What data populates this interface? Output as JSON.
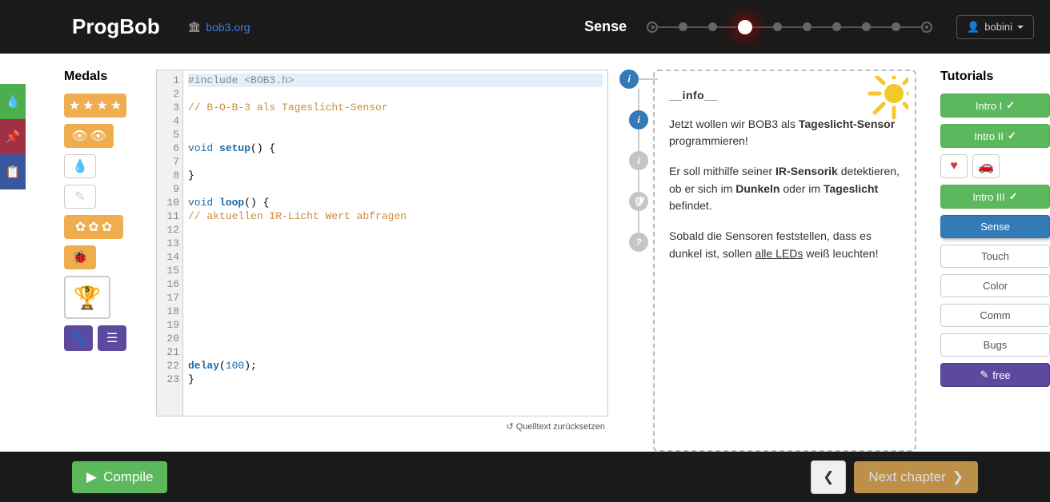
{
  "header": {
    "logo": "ProgBob",
    "domain": "bob3.org",
    "crumb": "Sense",
    "user": "bobini"
  },
  "medals": {
    "title": "Medals",
    "trophy_num": "5"
  },
  "editor": {
    "lines": [
      "1",
      "2",
      "3",
      "4",
      "5",
      "6",
      "7",
      "8",
      "9",
      "10",
      "11",
      "12",
      "13",
      "14",
      "15",
      "16",
      "17",
      "18",
      "19",
      "20",
      "21",
      "22",
      "23"
    ],
    "l1_a": "#include ",
    "l1_b": "<BOB3.h>",
    "l3": "// B-O-B-3 als Tageslicht-Sensor",
    "l6_a": "void",
    "l6_b": " setup",
    "l6_c": "() {",
    "l8": "}",
    "l10_a": "void",
    "l10_b": " loop",
    "l10_c": "() {",
    "l11": "  // aktuellen IR-Licht Wert abfragen",
    "l22_a": "  delay",
    "l22_b": "(",
    "l22_c": "100",
    "l22_d": ");",
    "l23": "}",
    "reset": "↺ Quelltext zurücksetzen"
  },
  "info": {
    "heading": "__info__",
    "p1_a": "Jetzt wollen wir BOB3 als ",
    "p1_b": "Tageslicht-Sensor",
    "p1_c": " programmieren!",
    "p2_a": "Er soll mithilfe seiner ",
    "p2_b": "IR-Sensorik",
    "p2_c": " detektieren, ob er sich im ",
    "p2_d": "Dunkeln",
    "p2_e": " oder im ",
    "p2_f": "Tageslicht",
    "p2_g": " befindet.",
    "p3_a": "Sobald die Sensoren feststellen, dass es dunkel ist, sollen ",
    "p3_b": "alle LEDs",
    "p3_c": " weiß leuchten!"
  },
  "tutorials": {
    "title": "Tutorials",
    "intro1": "Intro I",
    "intro2": "Intro II",
    "intro3": "Intro III",
    "sense": "Sense",
    "touch": "Touch",
    "color": "Color",
    "comm": "Comm",
    "bugs": "Bugs",
    "free": "free"
  },
  "footer": {
    "compile": "Compile",
    "next": "Next chapter"
  }
}
